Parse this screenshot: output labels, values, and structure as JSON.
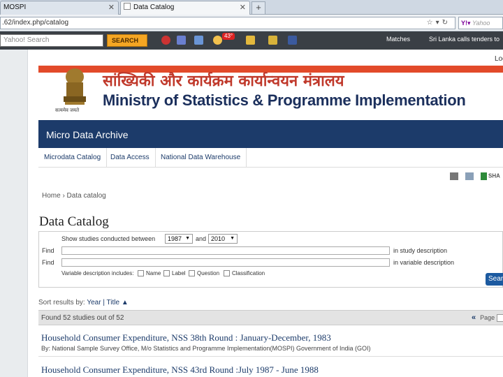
{
  "browser": {
    "tabs": [
      {
        "label": "MOSPI",
        "active": false
      },
      {
        "label": "Data Catalog",
        "active": true
      }
    ],
    "new_tab": "+",
    "url": ".62/index.php/catalog",
    "yahoo_search": "Yahoo",
    "toolbar": {
      "search_placeholder": "Yahoo! Search",
      "search_button": "SEARCH",
      "weather_badge": "43°",
      "links": [
        "Matches",
        "Sri Lanka calls tenders to"
      ]
    }
  },
  "header": {
    "hindi_title": "सांख्यिकी और कार्यक्रम कार्यान्वयन मंत्रालय",
    "english_title": "Ministry of Statistics & Programme Implementation",
    "emblem_caption": "सत्यमेव जयते",
    "login": "Log"
  },
  "section": {
    "title": "Micro Data Archive"
  },
  "menu": [
    "Microdata Catalog",
    "Data Access",
    "National Data Warehouse"
  ],
  "utilities": {
    "share": "SHA"
  },
  "breadcrumb": "Home › Data catalog",
  "page_title": "Data Catalog",
  "search": {
    "show_label": "Show studies conducted between",
    "from_year": "1987",
    "and_label": "and",
    "to_year": "2010",
    "find1_label": "Find",
    "find1_scope": "in study description",
    "find2_label": "Find",
    "find2_scope": "in variable description",
    "vd_includes": "Variable description includes:",
    "checkboxes": [
      "Name",
      "Label",
      "Question",
      "Classification"
    ],
    "button": "Sear"
  },
  "sort": {
    "label": "Sort results by:",
    "year": "Year",
    "sep": "|",
    "title": "Title"
  },
  "results": {
    "summary": "Found 52 studies out of 52",
    "pager_label": "Page"
  },
  "studies": [
    {
      "title": "Household Consumer Expenditure, NSS 38th Round : January-December, 1983",
      "by": "By: National Sample Survey Office, M/o Statistics and Programme Implementation(MOSPI) Government of India (GOI)"
    },
    {
      "title": "Household Consumer Expenditure, NSS 43rd Round :July 1987 - June 1988",
      "by": ""
    }
  ],
  "colors": {
    "navy": "#1c3b6a",
    "red": "#e24a2a",
    "yahoo_orange": "#f5a623"
  }
}
